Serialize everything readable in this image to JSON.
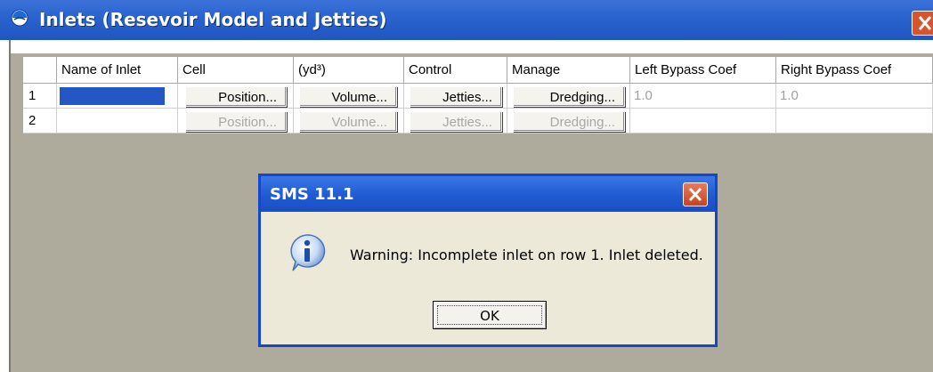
{
  "window": {
    "title": "Inlets (Resevoir Model and Jetties)"
  },
  "grid": {
    "columns": [
      "Name of Inlet",
      "Cell",
      "(yd³)",
      "Control",
      "Manage",
      "Left Bypass Coef",
      "Right Bypass Coef"
    ],
    "rows": [
      {
        "num": "1",
        "name": "",
        "cell": "Position...",
        "volume": "Volume...",
        "control": "Jetties...",
        "manage": "Dredging...",
        "left": "1.0",
        "right": "1.0",
        "enabled": true
      },
      {
        "num": "2",
        "name": "",
        "cell": "Position...",
        "volume": "Volume...",
        "control": "Jetties...",
        "manage": "Dredging...",
        "left": "",
        "right": "",
        "enabled": false
      }
    ]
  },
  "dialog": {
    "title": "SMS 11.1",
    "message": "Warning: Incomplete inlet on row 1. Inlet deleted.",
    "ok_label": "OK"
  },
  "icons": {
    "app": "globe-icon",
    "close": "close-icon",
    "info": "info-icon"
  },
  "colors": {
    "titlebar": "#2b63cf",
    "close_button": "#d9532c",
    "selection": "#2456c4"
  }
}
